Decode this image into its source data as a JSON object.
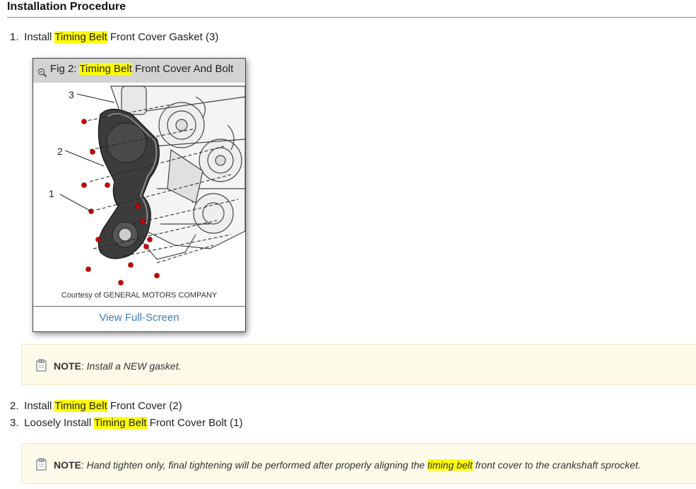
{
  "section": {
    "heading": "Installation Procedure"
  },
  "steps": [
    {
      "number": "1.",
      "prefix": "Install ",
      "highlight": "Timing Belt",
      "suffix": " Front Cover Gasket (3)"
    },
    {
      "number": "2.",
      "prefix": "Install ",
      "highlight": "Timing Belt",
      "suffix": " Front Cover (2)"
    },
    {
      "number": "3.",
      "prefix": "Loosely Install ",
      "highlight": "Timing Belt",
      "suffix": " Front Cover Bolt (1)"
    }
  ],
  "figure": {
    "title_prefix": "Fig 2: ",
    "title_highlight": "Timing Belt",
    "title_suffix": " Front Cover And Bolt",
    "callouts": [
      "3",
      "2",
      "1"
    ],
    "credit": "Courtesy of GENERAL MOTORS COMPANY",
    "fullscreen_label": "View Full-Screen",
    "zoom_icon": "zoom-in-icon"
  },
  "notes": [
    {
      "label": "NOTE",
      "sep": ": ",
      "body_prefix": "Install a NEW gasket.",
      "highlight": "",
      "body_suffix": ""
    },
    {
      "label": "NOTE",
      "sep": ": ",
      "body_prefix": "Hand tighten only, final tightening will be performed after properly aligning the ",
      "highlight": "timing belt",
      "body_suffix": " front cover to the crankshaft sprocket."
    }
  ],
  "colors": {
    "highlight": "#ffff00",
    "link": "#3a7fb6",
    "note_bg": "#fffbea",
    "bolt": "#cc0000"
  }
}
